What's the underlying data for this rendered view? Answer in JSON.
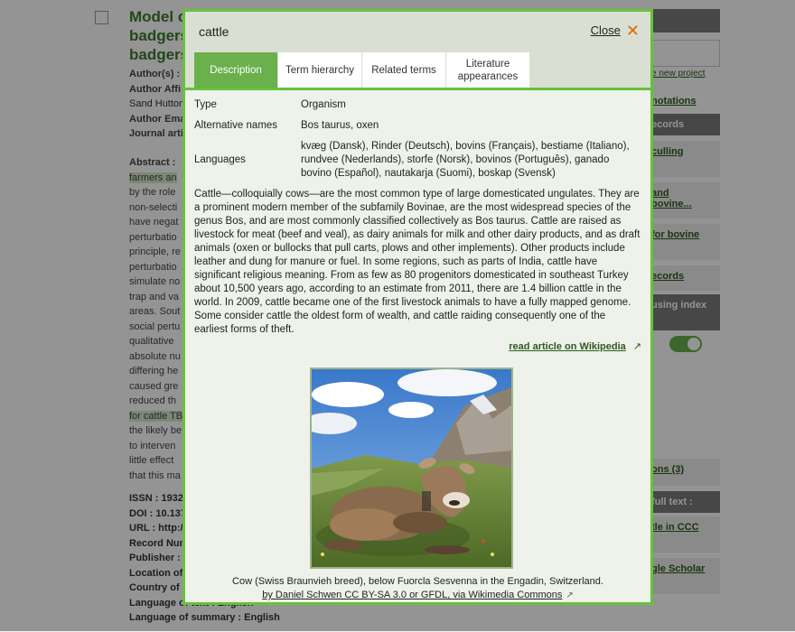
{
  "background": {
    "title": "Model c\nbadgers\nbadgers",
    "meta": [
      "Author(s) :",
      "Author Affi",
      "Sand Hutton",
      "Author Ema",
      "Journal arti"
    ],
    "abstract_label": "Abstract :",
    "abstract_words": [
      "farmers an",
      "by the role",
      "non-selecti",
      "have negat",
      "perturbatio",
      "principle, re",
      "perturbatio",
      "simulate no",
      "trap and va",
      "areas. Sout",
      "social pertu",
      "qualitative",
      "absolute nu",
      "differing he",
      "caused gre",
      "reduced th",
      "for cattle TB",
      "the likely be",
      "to interven",
      "little effect",
      "that this ma"
    ],
    "bottom": [
      "ISSN : 1932",
      "DOI : 10.137",
      "URL : http://",
      "Record Num",
      "Publisher :",
      "Location of",
      "Country of",
      "Language of text : English",
      "Language of summary : English"
    ],
    "right_panel": {
      "bar1": "",
      "link_project": "e new project",
      "annotations": "notations",
      "records_bar": "ecords",
      "culling": "culling",
      "and_bovine": "and\nbovine...",
      "for_bovine": "for bovine",
      "records_link": "ecords",
      "using_index": "using index",
      "ons": "ons (3)",
      "full_text": "full text :",
      "ccc": "tle in CCC",
      "scholar": "gle Scholar"
    }
  },
  "modal": {
    "title": "cattle",
    "close_label": "Close",
    "tabs": [
      {
        "label": "Description",
        "active": true
      },
      {
        "label": "Term hierarchy",
        "active": false
      },
      {
        "label": "Related terms",
        "active": false
      },
      {
        "label": "Literature appearances",
        "active": false
      }
    ],
    "type_label": "Type",
    "type_value": "Organism",
    "alt_label": "Alternative names",
    "alt_value": "Bos taurus, oxen",
    "lang_label": "Languages",
    "lang_value": "kvæg (Dansk), Rinder (Deutsch), bovins (Français), bestiame (Italiano), rundvee (Nederlands), storfe (Norsk), bovinos (Português), ganado bovino (Español), nautakarja (Suomi), boskap (Svensk)",
    "description": "Cattle—colloquially cows—are the most common type of large domesticated ungulates. They are a prominent modern member of the subfamily Bovinae, are the most widespread species of the genus Bos, and are most commonly classified collectively as Bos taurus. Cattle are raised as livestock for meat (beef and veal), as dairy animals for milk and other dairy products, and as draft animals (oxen or bullocks that pull carts, plows and other implements). Other products include leather and dung for manure or fuel. In some regions, such as parts of India, cattle have significant religious meaning. From as few as 80 progenitors domesticated in southeast Turkey about 10,500 years ago, according to an estimate from 2011, there are 1.4 billion cattle in the world. In 2009, cattle became one of the first livestock animals to have a fully mapped genome. Some consider cattle the oldest form of wealth, and cattle raiding consequently one of the earliest forms of theft.",
    "wiki_link": "read article on Wikipedia",
    "caption": "Cow (Swiss Braunvieh breed), below Fuorcla Sesvenna in the Engadin, Switzerland.",
    "credit": "by Daniel Schwen CC BY-SA 3.0 or GFDL, via Wikimedia Commons"
  },
  "colors": {
    "accent_green": "#6ab04c",
    "border_green": "#66c23a",
    "close_orange": "#e06a00"
  }
}
